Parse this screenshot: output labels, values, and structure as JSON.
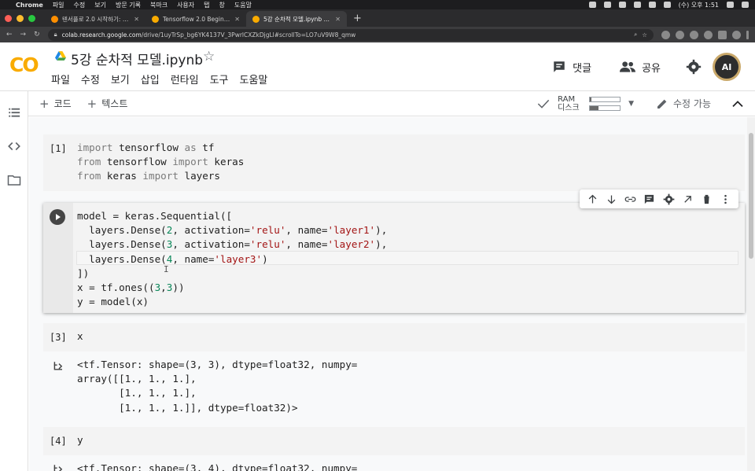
{
  "macos": {
    "apple": "",
    "app_name": "Chrome",
    "menu": [
      "파일",
      "수정",
      "보기",
      "방문 기록",
      "북마크",
      "사용자",
      "탭",
      "창",
      "도움말"
    ],
    "clock": "(수) 오후 1:51"
  },
  "browser": {
    "tabs": [
      {
        "title": "텐서플로 2.0 시작하기: 초보자용 | Te",
        "active": false
      },
      {
        "title": "Tensorflow 2.0 Beginner.ipynb",
        "active": false
      },
      {
        "title": "5강 순차적 모델.ipynb - Colabora",
        "active": true
      }
    ],
    "new_tab": "+",
    "url_host": "colab.research.google.com",
    "url_path": "/drive/1uyTrSp_bg6YK4137V_3PwrlCXZkDjgLl#scrollTo=LO7uV9W8_qmw"
  },
  "colab": {
    "logo_text": "CO",
    "notebook_title": "5강 순차적 모델.ipynb",
    "menu": [
      "파일",
      "수정",
      "보기",
      "삽입",
      "런타임",
      "도구",
      "도움말"
    ],
    "comment_label": "댓글",
    "share_label": "공유",
    "avatar_text": "AI"
  },
  "toolbar": {
    "add_code": "코드",
    "add_text": "텍스트",
    "ram_label": "RAM",
    "disk_label": "디스크",
    "ram_usage": 0.06,
    "disk_usage": 0.28,
    "edit_mode": "수정 가능"
  },
  "cells": {
    "cell1": {
      "count": "[1]",
      "lines": [
        [
          {
            "t": "import",
            "c": "kwg"
          },
          {
            "t": " tensorflow ",
            "c": ""
          },
          {
            "t": "as",
            "c": "kwg"
          },
          {
            "t": " tf",
            "c": ""
          }
        ],
        [
          {
            "t": "from",
            "c": "kwg"
          },
          {
            "t": " tensorflow ",
            "c": ""
          },
          {
            "t": "import",
            "c": "kwg"
          },
          {
            "t": " keras",
            "c": ""
          }
        ],
        [
          {
            "t": "from",
            "c": "kwg"
          },
          {
            "t": " keras ",
            "c": ""
          },
          {
            "t": "import",
            "c": "kwg"
          },
          {
            "t": " layers",
            "c": ""
          }
        ]
      ]
    },
    "cell2": {
      "lines": [
        [
          {
            "t": "model = keras.Sequential([",
            "c": ""
          }
        ],
        [
          {
            "t": "  layers.Dense(",
            "c": ""
          },
          {
            "t": "2",
            "c": "num"
          },
          {
            "t": ", activation=",
            "c": ""
          },
          {
            "t": "'relu'",
            "c": "str"
          },
          {
            "t": ", name=",
            "c": ""
          },
          {
            "t": "'layer1'",
            "c": "str"
          },
          {
            "t": "),",
            "c": ""
          }
        ],
        [
          {
            "t": "  layers.Dense(",
            "c": ""
          },
          {
            "t": "3",
            "c": "num"
          },
          {
            "t": ", activation=",
            "c": ""
          },
          {
            "t": "'relu'",
            "c": "str"
          },
          {
            "t": ", name=",
            "c": ""
          },
          {
            "t": "'layer2'",
            "c": "str"
          },
          {
            "t": "),",
            "c": ""
          }
        ],
        [
          {
            "t": "  layers.Dense(",
            "c": ""
          },
          {
            "t": "4",
            "c": "num"
          },
          {
            "t": ", name=",
            "c": ""
          },
          {
            "t": "'layer3'",
            "c": "str"
          },
          {
            "t": ")",
            "c": ""
          }
        ],
        [
          {
            "t": "])",
            "c": ""
          }
        ],
        [
          {
            "t": "x = tf.ones((",
            "c": ""
          },
          {
            "t": "3",
            "c": "num"
          },
          {
            "t": ",",
            "c": ""
          },
          {
            "t": "3",
            "c": "num"
          },
          {
            "t": "))",
            "c": ""
          }
        ],
        [
          {
            "t": "y = model(x)",
            "c": ""
          }
        ]
      ]
    },
    "cell3": {
      "count": "[3]",
      "source": "x",
      "output": "<tf.Tensor: shape=(3, 3), dtype=float32, numpy=\narray([[1., 1., 1.],\n       [1., 1., 1.],\n       [1., 1., 1.]], dtype=float32)>"
    },
    "cell4": {
      "count": "[4]",
      "source": "y",
      "output": "<tf.Tensor: shape=(3, 4), dtype=float32, numpy="
    }
  },
  "colors": {
    "accent": "#f9ab00",
    "icon_gray": "#5f6368"
  }
}
